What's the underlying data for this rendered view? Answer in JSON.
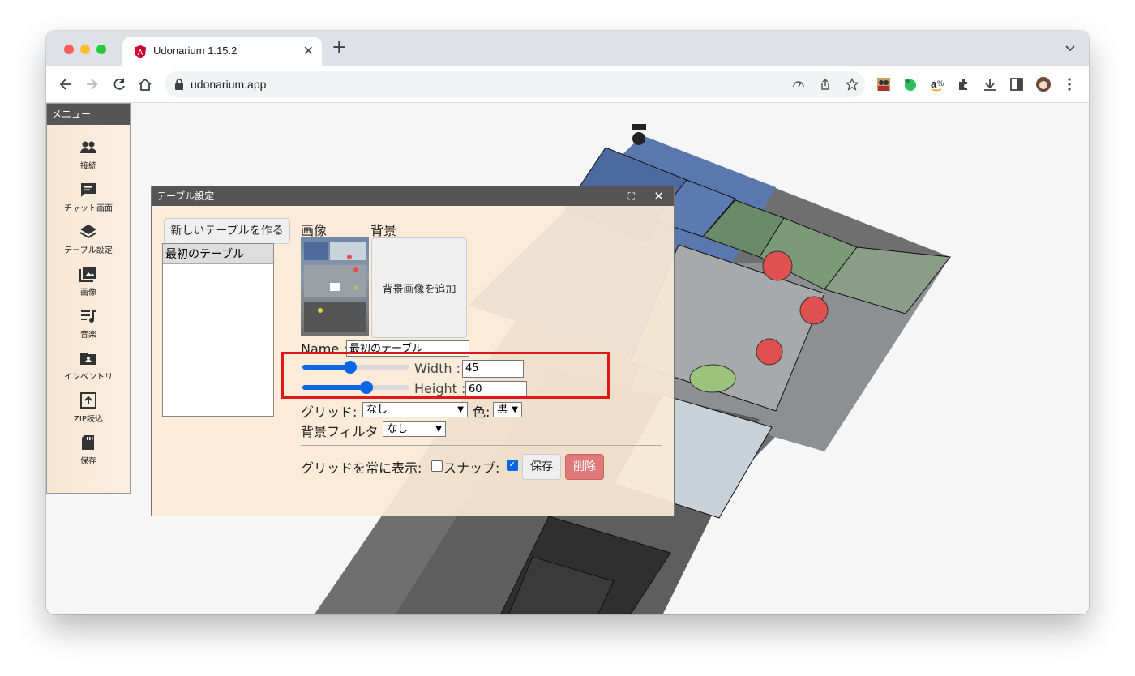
{
  "browser": {
    "tab_title": "Udonarium 1.15.2",
    "url": "udonarium.app"
  },
  "menu": {
    "title": "メニュー",
    "items": [
      {
        "label": "接続",
        "icon": "people-icon"
      },
      {
        "label": "チャット画面",
        "icon": "chat-icon"
      },
      {
        "label": "テーブル設定",
        "icon": "layers-icon"
      },
      {
        "label": "画像",
        "icon": "image-icon"
      },
      {
        "label": "音楽",
        "icon": "music-icon"
      },
      {
        "label": "インベントリ",
        "icon": "folder-icon"
      },
      {
        "label": "ZIP読込",
        "icon": "upload-icon"
      },
      {
        "label": "保存",
        "icon": "sd-card-icon"
      }
    ]
  },
  "dialog": {
    "title": "テーブル設定",
    "new_table_button": "新しいテーブルを作る",
    "tables": [
      "最初のテーブル"
    ],
    "image_label": "画像",
    "background_label": "背景",
    "add_background_button": "背景画像を追加",
    "name_label": "Name :",
    "name_value": "最初のテーブル",
    "width_label": "Width :",
    "width_value": "45",
    "height_label": "Height :",
    "height_value": "60",
    "grid_label": "グリッド:",
    "grid_value": "なし",
    "color_label": "色:",
    "color_value": "黒",
    "filter_label": "背景フィルタ",
    "filter_value": "なし",
    "always_show_grid_label": "グリッドを常に表示:",
    "snap_label": "スナップ:",
    "snap_checked": true,
    "always_show_grid_checked": false,
    "save_button": "保存",
    "delete_button": "削除",
    "width_slider_fraction": 0.45,
    "height_slider_fraction": 0.6
  },
  "colors": {
    "accent": "#0b66e4",
    "delete": "#e07a7a",
    "highlight": "#e11818"
  }
}
